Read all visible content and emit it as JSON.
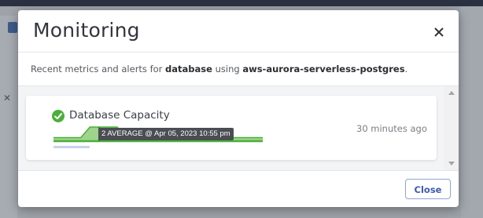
{
  "modal": {
    "title": "Monitoring",
    "description": {
      "prefix": "Recent metrics and alerts for ",
      "resource": "database",
      "middle": " using ",
      "engine": "aws-aurora-serverless-postgres",
      "suffix": "."
    },
    "footer": {
      "close_label": "Close"
    }
  },
  "metrics": [
    {
      "name": "Database Capacity",
      "status": "ok",
      "status_icon": "check-circle-icon",
      "updated": "30 minutes ago",
      "tooltip": "2 AVERAGE @ Apr 05, 2023 10:55 pm",
      "sparkline": {
        "ylim": [
          0,
          2
        ],
        "values": [
          0.5,
          0.5,
          0.5,
          0.5,
          2,
          2,
          2,
          2,
          0.5,
          0.5,
          0.5,
          0.5,
          0.5,
          0.5,
          0.5,
          0.5,
          0.5,
          0.5,
          0.5,
          0.5,
          0.5,
          0.5,
          0.5,
          0.5
        ],
        "highlight_index": 5
      }
    }
  ],
  "colors": {
    "accent": "#3e5bb0",
    "success": "#4caf3a",
    "sparkline_fill": "#9ed48c",
    "sparkline_line": "#4caf3a"
  }
}
